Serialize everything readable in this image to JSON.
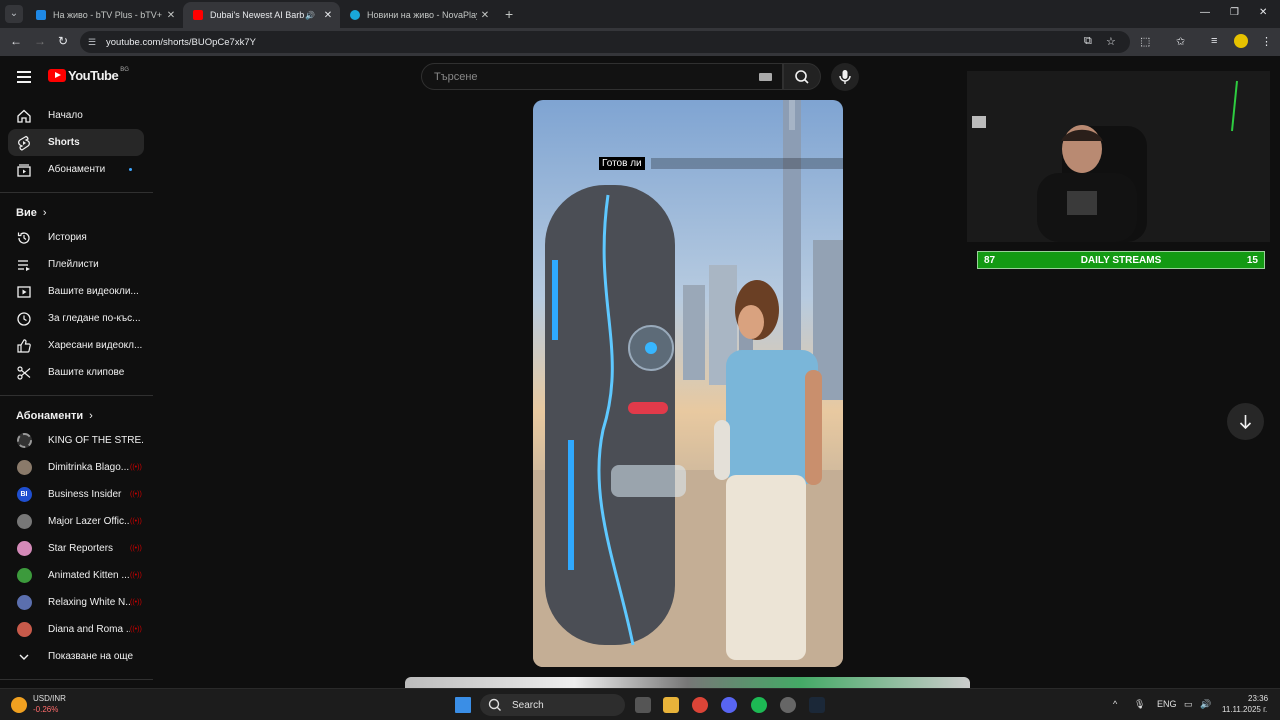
{
  "browser": {
    "tabs": [
      {
        "title": "На живо - bTV Plus - bTV+",
        "close": "✕"
      },
      {
        "title": "Dubai's Newest AI Barber I",
        "close": "✕"
      },
      {
        "title": "Новини на живо - NovaPlay",
        "close": "✕"
      }
    ],
    "new_tab": "+",
    "url": "youtube.com/shorts/BUOpCe7xk7Y"
  },
  "youtube": {
    "logo_text": "YouTube",
    "country_code": "BG",
    "search_placeholder": "Търсене"
  },
  "sidebar": {
    "main": [
      {
        "label": "Начало"
      },
      {
        "label": "Shorts"
      },
      {
        "label": "Абонаменти"
      }
    ],
    "you_header": "Вие",
    "you": [
      {
        "label": "История"
      },
      {
        "label": "Плейлисти"
      },
      {
        "label": "Вашите видеокли..."
      },
      {
        "label": "За гледане по-къс..."
      },
      {
        "label": "Харесани видеокл..."
      },
      {
        "label": "Вашите клипове"
      }
    ],
    "subs_header": "Абонаменти",
    "subs": [
      {
        "label": "KING OF THE STRE...",
        "color": "#333333"
      },
      {
        "label": "Dimitrinka Blago...",
        "color": "#8a7a6a"
      },
      {
        "label": "Business Insider",
        "color": "#1f4fd0",
        "initials": "BI"
      },
      {
        "label": "Major Lazer Offic...",
        "color": "#777777"
      },
      {
        "label": "Star Reporters",
        "color": "#d48ab8"
      },
      {
        "label": "Animated Kitten ...",
        "color": "#3c9a3c"
      },
      {
        "label": "Relaxing White N...",
        "color": "#5b6fae"
      },
      {
        "label": "Diana and Roma ...",
        "color": "#c75a4a"
      }
    ],
    "show_more": "Показване на още"
  },
  "video": {
    "caption": "Готов ли"
  },
  "overlay": {
    "left_count": "87",
    "title": "DAILY STREAMS",
    "right_count": "15"
  },
  "taskbar": {
    "search_label": "Search",
    "currency_pair": "USD/INR",
    "currency_change": "-0.26%",
    "language": "ENG",
    "time": "23:36",
    "date": "11.11.2025 г."
  }
}
